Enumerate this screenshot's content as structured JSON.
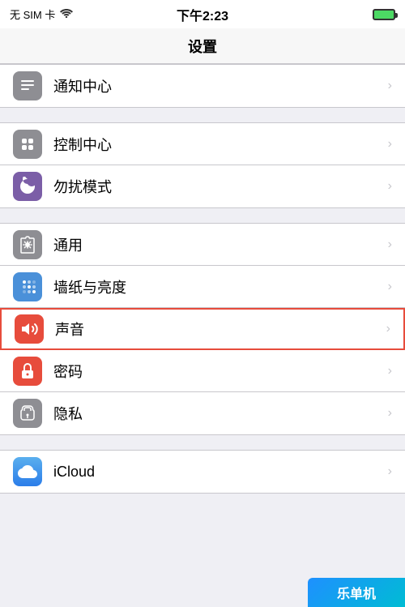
{
  "statusBar": {
    "carrier": "无 SIM 卡",
    "wifi": "WiFi",
    "time": "下午2:23",
    "battery": "100%"
  },
  "navBar": {
    "title": "设置"
  },
  "sections": [
    {
      "id": "section0",
      "items": [
        {
          "id": "notification",
          "label": "通知中心",
          "iconBg": "gray",
          "iconType": "notification"
        }
      ]
    },
    {
      "id": "section1",
      "items": [
        {
          "id": "control",
          "label": "控制中心",
          "iconBg": "gray",
          "iconType": "control"
        },
        {
          "id": "donotdisturb",
          "label": "勿扰模式",
          "iconBg": "purple",
          "iconType": "moon"
        }
      ]
    },
    {
      "id": "section2",
      "items": [
        {
          "id": "general",
          "label": "通用",
          "iconBg": "gray",
          "iconType": "gear"
        },
        {
          "id": "wallpaper",
          "label": "墙纸与亮度",
          "iconBg": "blue",
          "iconType": "flower"
        },
        {
          "id": "sound",
          "label": "声音",
          "iconBg": "red",
          "iconType": "sound",
          "highlighted": true
        },
        {
          "id": "passcode",
          "label": "密码",
          "iconBg": "red",
          "iconType": "lock"
        },
        {
          "id": "privacy",
          "label": "隐私",
          "iconBg": "gray",
          "iconType": "hand"
        }
      ]
    },
    {
      "id": "section3",
      "items": [
        {
          "id": "icloud",
          "label": "iCloud",
          "iconBg": "icloud",
          "iconType": "icloud"
        }
      ]
    }
  ],
  "branding": {
    "text": "乐单机"
  }
}
